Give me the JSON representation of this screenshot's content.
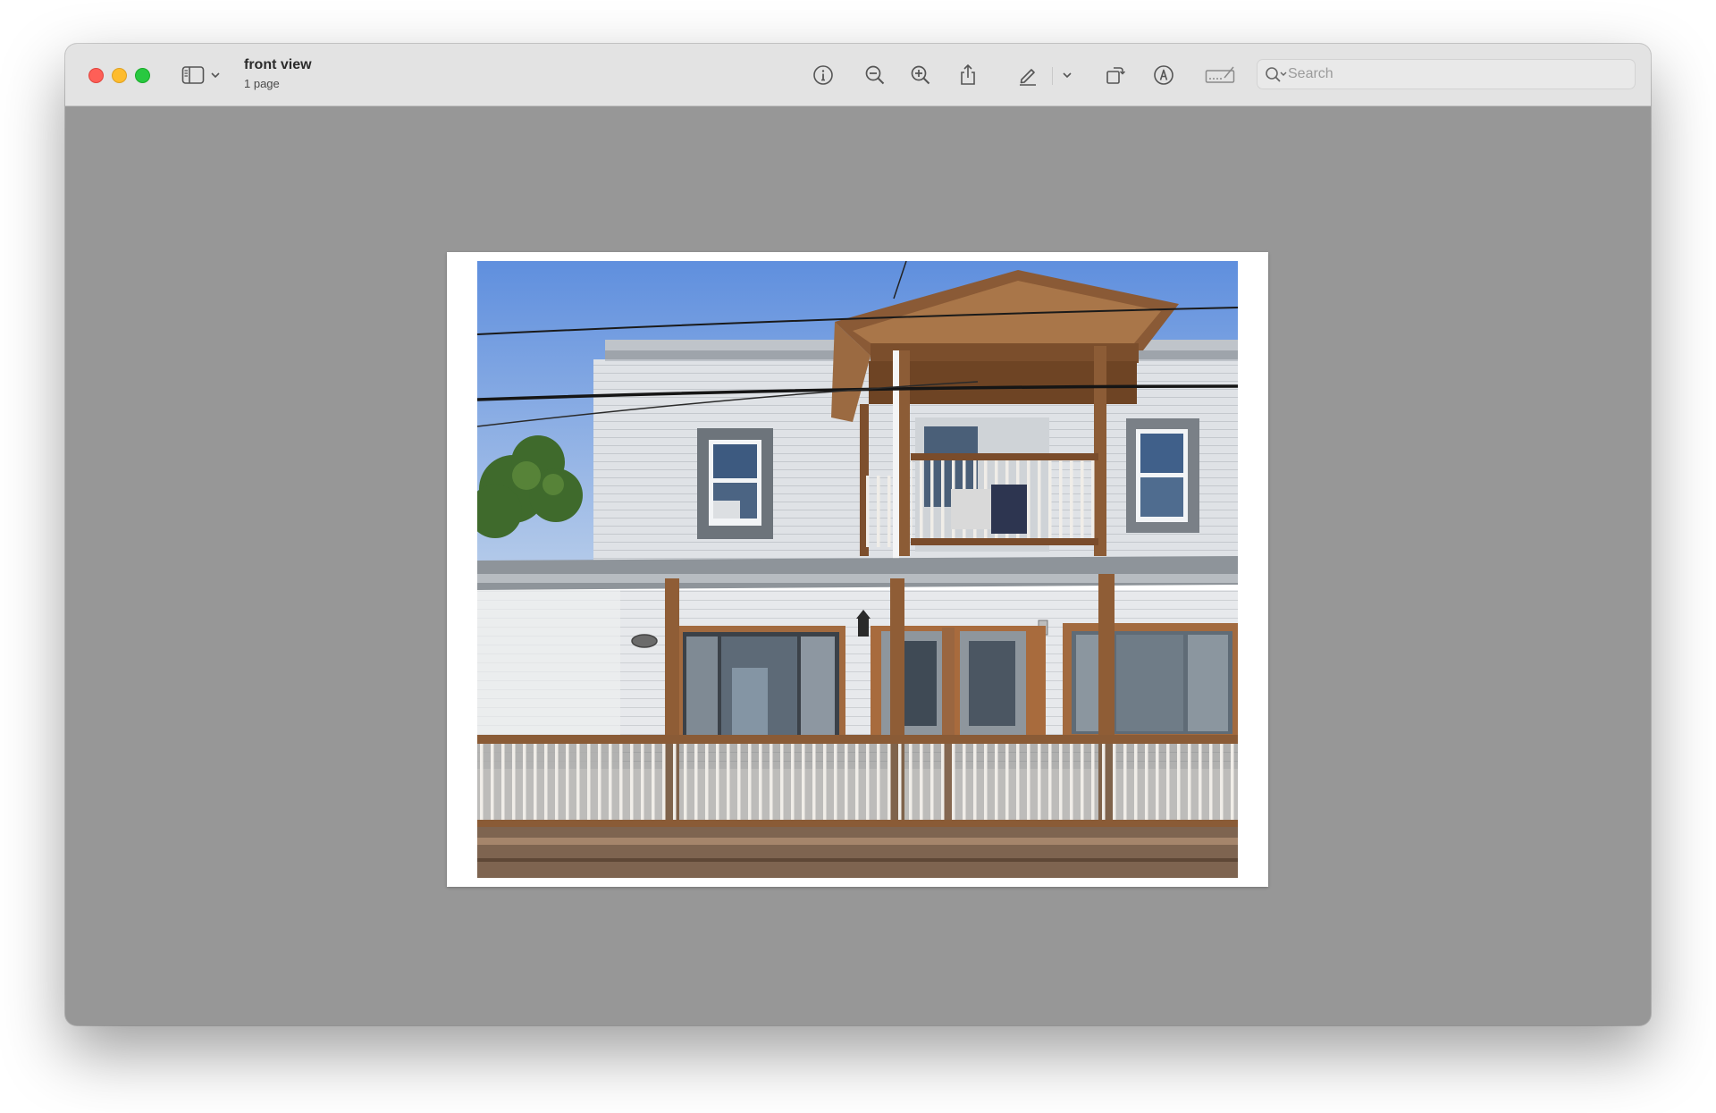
{
  "window": {
    "document_title": "front view",
    "page_count": "1 page"
  },
  "toolbar": {
    "items": [
      {
        "name": "sidebar-toggle",
        "icon": "sidebar-icon"
      },
      {
        "name": "sidebar-menu",
        "icon": "chevron-down-icon"
      },
      {
        "name": "info",
        "icon": "info-icon"
      },
      {
        "name": "zoom-out",
        "icon": "zoom-out-icon"
      },
      {
        "name": "zoom-in",
        "icon": "zoom-in-icon"
      },
      {
        "name": "share",
        "icon": "share-icon"
      },
      {
        "name": "highlight",
        "icon": "pencil-icon"
      },
      {
        "name": "highlight-menu",
        "icon": "chevron-down-icon"
      },
      {
        "name": "rotate",
        "icon": "rotate-icon"
      },
      {
        "name": "markup",
        "icon": "markup-icon"
      },
      {
        "name": "sign",
        "icon": "signature-icon"
      }
    ]
  },
  "search": {
    "placeholder": "Search",
    "value": ""
  },
  "colors": {
    "titlebar": "#e3e3e3",
    "canvas": "#979797",
    "close": "#fe5f57",
    "minimize": "#febc2e",
    "maximize": "#28c840"
  }
}
